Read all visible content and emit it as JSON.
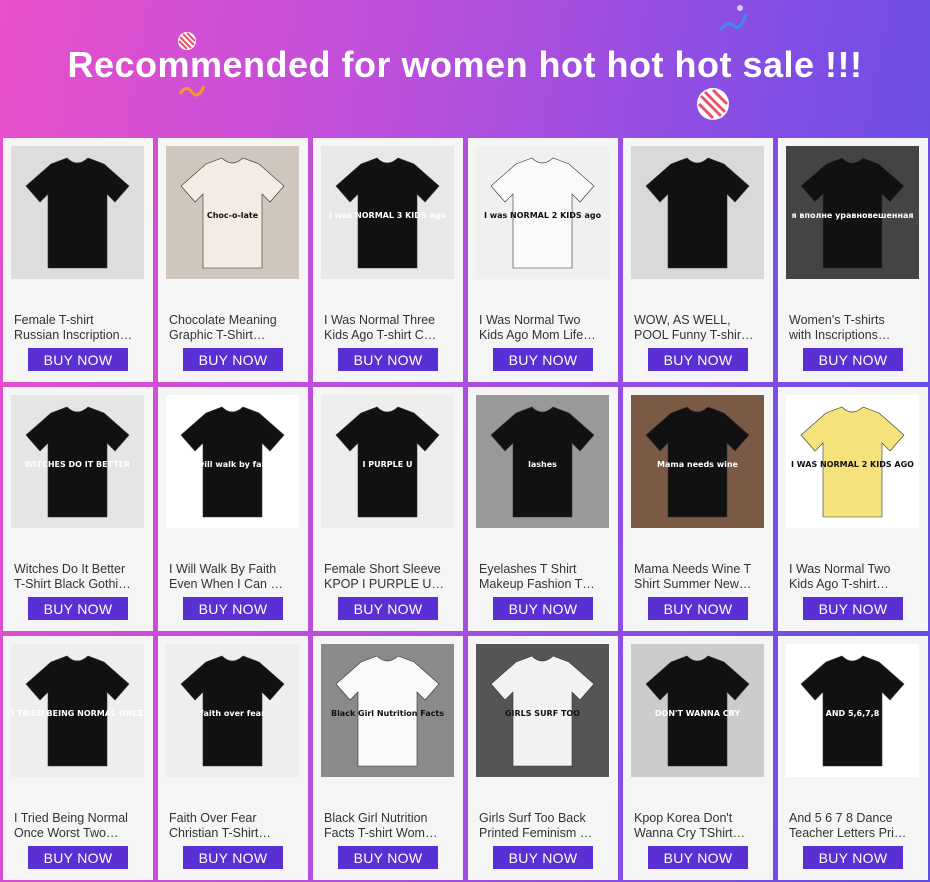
{
  "banner": {
    "title": "Recommended for women hot hot hot sale !!!"
  },
  "buy_label": "BUY NOW",
  "products": [
    {
      "line1": "Female T-shirt",
      "line2": "Russian Inscription…",
      "image": "tshirt-photo-icon",
      "shirt": "#111",
      "bg": "#ddd",
      "print": ""
    },
    {
      "line1": "Chocolate Meaning",
      "line2": "Graphic T-Shirt…",
      "image": "tshirt-photo-icon",
      "shirt": "#f2ece4",
      "bg": "#cfc6bd",
      "print": "Choc-o-late"
    },
    {
      "line1": "I Was Normal Three",
      "line2": "Kids Ago T-shirt C…",
      "image": "tshirt-photo-icon",
      "shirt": "#111",
      "bg": "#e8e8e8",
      "print": "I was NORMAL 3 KIDS ago"
    },
    {
      "line1": "I Was Normal Two",
      "line2": "Kids Ago Mom Life…",
      "image": "tshirt-photo-icon",
      "shirt": "#fafafa",
      "bg": "#f0f0f0",
      "print": "I was NORMAL 2 KIDS ago"
    },
    {
      "line1": "WOW, AS WELL,",
      "line2": "POOL Funny T-shir…",
      "image": "tshirt-photo-icon",
      "shirt": "#111",
      "bg": "#d9d9d9",
      "print": ""
    },
    {
      "line1": "Women's T-shirts",
      "line2": "with Inscriptions…",
      "image": "tshirt-photo-icon",
      "shirt": "#111",
      "bg": "#444",
      "print": "я вполне уравновешенная"
    },
    {
      "line1": "Witches Do It Better",
      "line2": "T-Shirt Black Gothi…",
      "image": "tshirt-photo-icon",
      "shirt": "#111",
      "bg": "#e5e5e5",
      "print": "WITCHES DO IT BETTER"
    },
    {
      "line1": "I Will Walk By Faith",
      "line2": "Even When I Can …",
      "image": "tshirt-photo-icon",
      "shirt": "#111",
      "bg": "#fff",
      "print": "I will walk by faith"
    },
    {
      "line1": "Female Short Sleeve",
      "line2": "KPOP I PURPLE U…",
      "image": "tshirt-photo-icon",
      "shirt": "#111",
      "bg": "#eee",
      "print": "I PURPLE U"
    },
    {
      "line1": "Eyelashes T Shirt",
      "line2": "Makeup Fashion T…",
      "image": "tshirt-photo-icon",
      "shirt": "#111",
      "bg": "#999",
      "print": "lashes"
    },
    {
      "line1": "Mama Needs Wine T",
      "line2": "Shirt Summer New…",
      "image": "tshirt-photo-icon",
      "shirt": "#111",
      "bg": "#7a5a44",
      "print": "Mama needs wine"
    },
    {
      "line1": "I Was Normal Two",
      "line2": "Kids Ago T-shirt…",
      "image": "tshirt-photo-icon",
      "shirt": "#f5e27a",
      "bg": "#fff",
      "print": "I WAS NORMAL 2 KIDS AGO"
    },
    {
      "line1": "I Tried Being Normal",
      "line2": "Once Worst Two…",
      "image": "tshirt-photo-icon",
      "shirt": "#111",
      "bg": "#eee",
      "print": "I TRIED BEING NORMAL ONCE"
    },
    {
      "line1": "Faith Over Fear",
      "line2": "Christian T-Shirt…",
      "image": "tshirt-photo-icon",
      "shirt": "#111",
      "bg": "#eee",
      "print": "faith over fear"
    },
    {
      "line1": "Black Girl Nutrition",
      "line2": "Facts T-shirt Wom…",
      "image": "tshirt-photo-icon",
      "shirt": "#fafafa",
      "bg": "#8a8a8a",
      "print": "Black Girl Nutrition Facts"
    },
    {
      "line1": "Girls Surf Too Back",
      "line2": "Printed Feminism …",
      "image": "tshirt-photo-icon",
      "shirt": "#f2f2f2",
      "bg": "#555",
      "print": "GIRLS SURF TOO"
    },
    {
      "line1": "Kpop Korea Don't",
      "line2": "Wanna Cry TShirt…",
      "image": "tshirt-photo-icon",
      "shirt": "#111",
      "bg": "#ccc",
      "print": "DON'T WANNA CRY"
    },
    {
      "line1": "And 5 6 7 8 Dance",
      "line2": "Teacher Letters Pri…",
      "image": "tshirt-photo-icon",
      "shirt": "#111",
      "bg": "#fff",
      "print": "AND 5,6,7,8"
    }
  ]
}
